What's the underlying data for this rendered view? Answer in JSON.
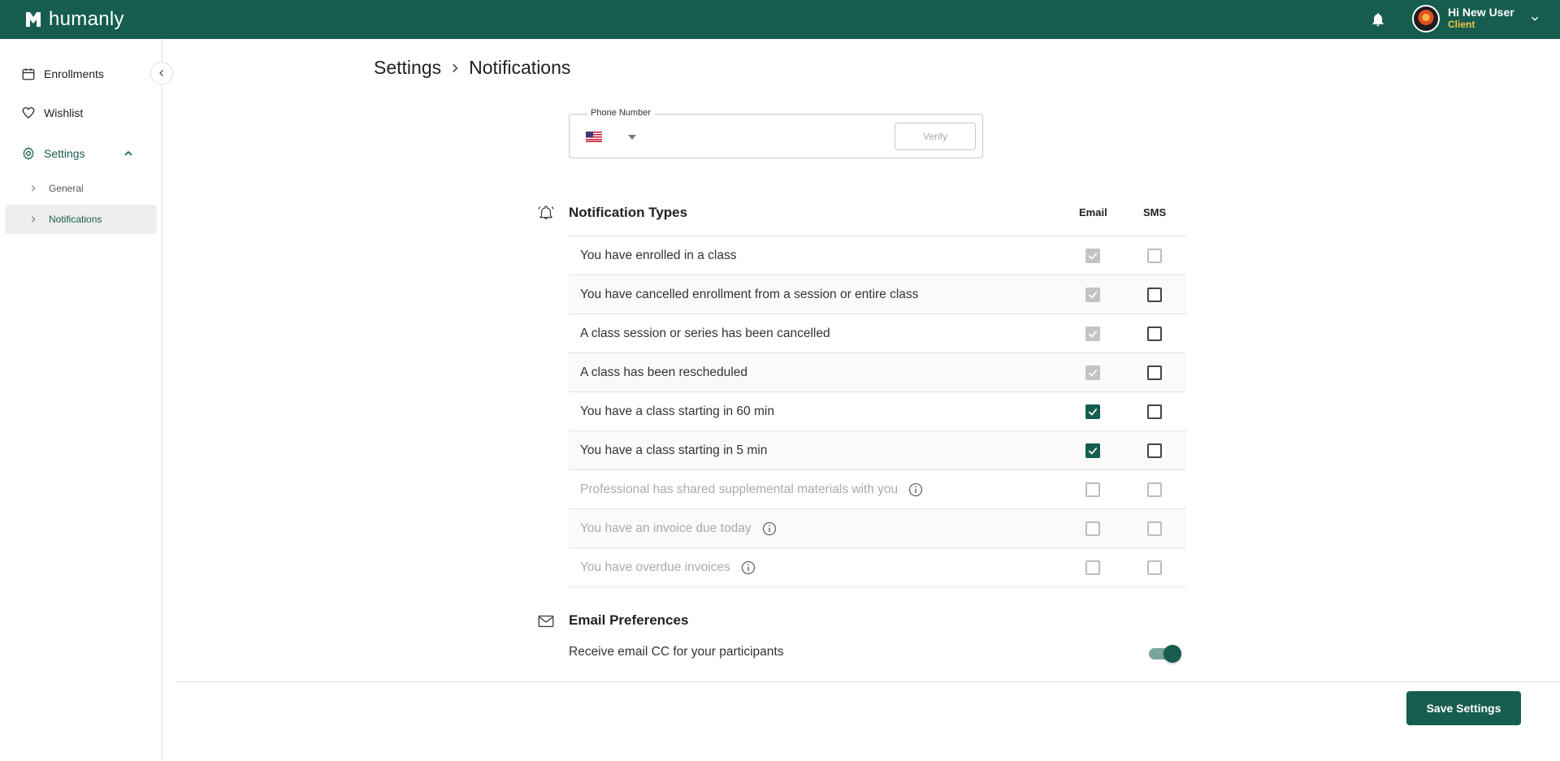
{
  "header": {
    "brand": "humanly",
    "user_name": "Hi New User",
    "user_role": "Client",
    "icons": [
      "bell-icon",
      "chevron-down-icon"
    ]
  },
  "sidebar": {
    "items": [
      {
        "label": "Enrollments",
        "icon": "calendar-icon"
      },
      {
        "label": "Wishlist",
        "icon": "heart-icon"
      },
      {
        "label": "Settings",
        "icon": "gear-icon"
      }
    ],
    "sub_items": [
      {
        "label": "General"
      },
      {
        "label": "Notifications"
      }
    ]
  },
  "breadcrumb": {
    "parent": "Settings",
    "current": "Notifications"
  },
  "phone": {
    "label": "Phone Number",
    "value": "",
    "country": "US",
    "verify_label": "Verify"
  },
  "notifications": {
    "title": "Notification Types",
    "col_email": "Email",
    "col_sms": "SMS",
    "rows": [
      {
        "label": "You have enrolled in a class",
        "email": "checked-disabled",
        "sms": "disabled",
        "info": false,
        "enabled": true
      },
      {
        "label": "You have cancelled enrollment from a session or entire class",
        "email": "checked-disabled",
        "sms": "unchecked",
        "info": false,
        "enabled": true
      },
      {
        "label": "A class session or series has been cancelled",
        "email": "checked-disabled",
        "sms": "unchecked",
        "info": false,
        "enabled": true
      },
      {
        "label": "A class has been rescheduled",
        "email": "checked-disabled",
        "sms": "unchecked",
        "info": false,
        "enabled": true
      },
      {
        "label": "You have a class starting in 60 min",
        "email": "checked",
        "sms": "unchecked",
        "info": false,
        "enabled": true
      },
      {
        "label": "You have a class starting in 5 min",
        "email": "checked",
        "sms": "unchecked",
        "info": false,
        "enabled": true
      },
      {
        "label": "Professional has shared supplemental materials with you",
        "email": "disabled",
        "sms": "disabled",
        "info": true,
        "enabled": false
      },
      {
        "label": "You have an invoice due today",
        "email": "disabled",
        "sms": "disabled",
        "info": true,
        "enabled": false
      },
      {
        "label": "You have overdue invoices",
        "email": "disabled",
        "sms": "disabled",
        "info": true,
        "enabled": false
      }
    ]
  },
  "email_prefs": {
    "title": "Email Preferences",
    "cc_label": "Receive email CC for your participants",
    "cc_enabled": true
  },
  "footer": {
    "save_label": "Save Settings"
  },
  "colors": {
    "brand": "#165d4f",
    "role": "#f5c542"
  }
}
